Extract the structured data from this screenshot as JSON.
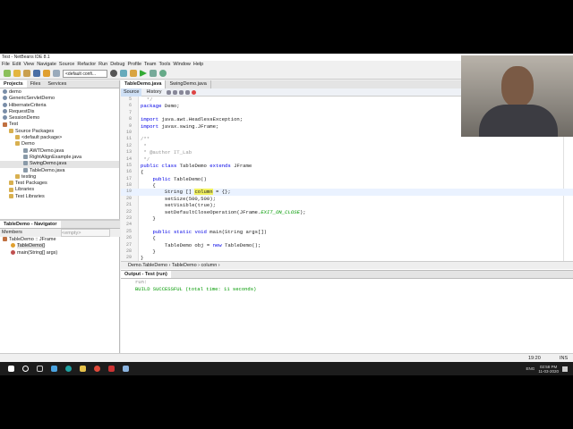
{
  "window": {
    "title": "Test - NetBeans IDE 8.1"
  },
  "menu": [
    "File",
    "Edit",
    "View",
    "Navigate",
    "Source",
    "Refactor",
    "Run",
    "Debug",
    "Profile",
    "Team",
    "Tools",
    "Window",
    "Help"
  ],
  "toolbar": {
    "config": "<default confi..."
  },
  "projects": {
    "tabs": [
      "Projects",
      "Files",
      "Services"
    ],
    "tree": [
      "demo",
      "GenericServletDemo",
      "HibernateCriteria",
      "RequestDis",
      "SessionDemo",
      "Test",
      "Source Packages",
      "<default package>",
      "Demo",
      "AWTDemo.java",
      "RightAlignExample.java",
      "SwingDemo.java",
      "TableDemo.java",
      "testing",
      "Test Packages",
      "Libraries",
      "Test Libraries"
    ]
  },
  "navigator": {
    "title": "TableDemo - Navigator",
    "filter": "Members",
    "empty": "<empty>",
    "items": [
      "TableDemo :: JFrame",
      "TableDemo()",
      "main(String[] args)"
    ]
  },
  "editor": {
    "tabs": [
      "TableDemo.java",
      "SwingDemo.java"
    ],
    "source": "Source",
    "history": "History",
    "lines": [
      {
        "n": "5",
        "t": "  */"
      },
      {
        "n": "6",
        "t": "package Demo;"
      },
      {
        "n": "7",
        "t": ""
      },
      {
        "n": "8",
        "t": "import java.awt.HeadlessException;"
      },
      {
        "n": "9",
        "t": "import javax.swing.JFrame;"
      },
      {
        "n": "10",
        "t": ""
      },
      {
        "n": "11",
        "t": "/**"
      },
      {
        "n": "12",
        "t": " *"
      },
      {
        "n": "13",
        "t": " * @author IT_Lab"
      },
      {
        "n": "14",
        "t": " */"
      },
      {
        "n": "15",
        "t": "public class TableDemo extends JFrame"
      },
      {
        "n": "16",
        "t": "{"
      },
      {
        "n": "17",
        "t": "    public TableDemo()"
      },
      {
        "n": "18",
        "t": "    {"
      },
      {
        "n": "19",
        "t": "        String [] column = {};"
      },
      {
        "n": "20",
        "t": "        setSize(500,500);"
      },
      {
        "n": "21",
        "t": "        setVisible(true);"
      },
      {
        "n": "22",
        "t": "        setDefaultCloseOperation(JFrame.EXIT_ON_CLOSE);"
      },
      {
        "n": "23",
        "t": "    }"
      },
      {
        "n": "24",
        "t": ""
      },
      {
        "n": "25",
        "t": "    public static void main(String args[])"
      },
      {
        "n": "26",
        "t": "    {"
      },
      {
        "n": "27",
        "t": "        TableDemo obj = new TableDemo();"
      },
      {
        "n": "28",
        "t": "    }"
      },
      {
        "n": "29",
        "t": "}"
      }
    ],
    "breadcrumb": [
      "Demo.TableDemo",
      "TableDemo",
      "column"
    ]
  },
  "output": {
    "title": "Output - Test (run)",
    "lines": [
      "run:",
      "BUILD SUCCESSFUL (total time: 11 seconds)"
    ]
  },
  "status": {
    "position": "19:20",
    "mode": "INS"
  },
  "taskbar": {
    "time": "02:58 PM",
    "date": "11-03-2020",
    "lang": "ENG"
  }
}
